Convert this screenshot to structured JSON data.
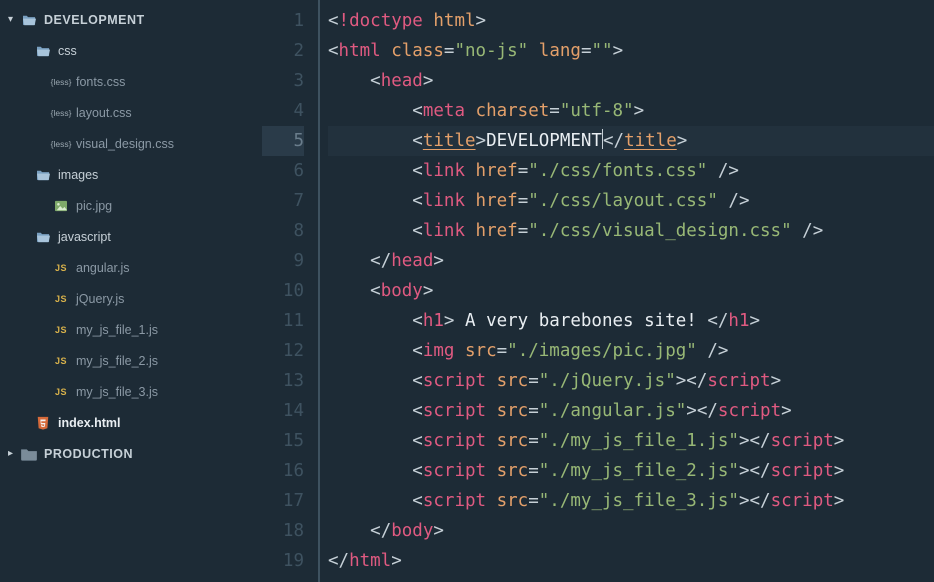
{
  "sidebar": {
    "items": [
      {
        "type": "root-open",
        "label": "DEVELOPMENT"
      },
      {
        "type": "folder-open",
        "indent": 1,
        "label": "css"
      },
      {
        "type": "less-file",
        "indent": 2,
        "label": "fonts.css"
      },
      {
        "type": "less-file",
        "indent": 2,
        "label": "layout.css"
      },
      {
        "type": "less-file",
        "indent": 2,
        "label": "visual_design.css"
      },
      {
        "type": "folder-open",
        "indent": 1,
        "label": "images"
      },
      {
        "type": "image-file",
        "indent": 2,
        "label": "pic.jpg"
      },
      {
        "type": "folder-open",
        "indent": 1,
        "label": "javascript"
      },
      {
        "type": "js-file",
        "indent": 2,
        "label": "angular.js"
      },
      {
        "type": "js-file",
        "indent": 2,
        "label": "jQuery.js"
      },
      {
        "type": "js-file",
        "indent": 2,
        "label": "my_js_file_1.js"
      },
      {
        "type": "js-file",
        "indent": 2,
        "label": "my_js_file_2.js"
      },
      {
        "type": "js-file",
        "indent": 2,
        "label": "my_js_file_3.js"
      },
      {
        "type": "html-file",
        "indent": 1,
        "label": "index.html",
        "bold": true
      },
      {
        "type": "root-closed",
        "label": "PRODUCTION"
      }
    ]
  },
  "editor": {
    "active_line": 5,
    "lines": [
      {
        "n": 1,
        "tokens": [
          [
            "<",
            "punct"
          ],
          [
            "!doctype ",
            "bang"
          ],
          [
            "html",
            "attr"
          ],
          [
            ">",
            "punct"
          ]
        ]
      },
      {
        "n": 2,
        "tokens": [
          [
            "<",
            "punct"
          ],
          [
            "html ",
            "tag"
          ],
          [
            "class",
            "attr"
          ],
          [
            "=",
            "punct"
          ],
          [
            "\"no-js\"",
            "str"
          ],
          [
            " ",
            "punct"
          ],
          [
            "lang",
            "attr"
          ],
          [
            "=",
            "punct"
          ],
          [
            "\"\"",
            "str"
          ],
          [
            ">",
            "punct"
          ]
        ]
      },
      {
        "n": 3,
        "indent": 1,
        "tokens": [
          [
            "<",
            "punct"
          ],
          [
            "head",
            "tag"
          ],
          [
            ">",
            "punct"
          ]
        ]
      },
      {
        "n": 4,
        "indent": 2,
        "tokens": [
          [
            "<",
            "punct"
          ],
          [
            "meta ",
            "tag"
          ],
          [
            "charset",
            "attr"
          ],
          [
            "=",
            "punct"
          ],
          [
            "\"utf-8\"",
            "str"
          ],
          [
            ">",
            "punct"
          ]
        ]
      },
      {
        "n": 5,
        "indent": 2,
        "active": true,
        "tokens": [
          [
            "<",
            "punct"
          ],
          [
            "title",
            "tag-title"
          ],
          [
            ">",
            "punct"
          ],
          [
            "DEVELOPMENT",
            "text"
          ],
          [
            "|",
            "cursor"
          ],
          [
            "</",
            "punct"
          ],
          [
            "title",
            "tag-title"
          ],
          [
            ">",
            "punct"
          ]
        ]
      },
      {
        "n": 6,
        "indent": 2,
        "tokens": [
          [
            "<",
            "punct"
          ],
          [
            "link ",
            "tag"
          ],
          [
            "href",
            "attr"
          ],
          [
            "=",
            "punct"
          ],
          [
            "\"./css/fonts.css\"",
            "str"
          ],
          [
            " />",
            "punct"
          ]
        ]
      },
      {
        "n": 7,
        "indent": 2,
        "tokens": [
          [
            "<",
            "punct"
          ],
          [
            "link ",
            "tag"
          ],
          [
            "href",
            "attr"
          ],
          [
            "=",
            "punct"
          ],
          [
            "\"./css/layout.css\"",
            "str"
          ],
          [
            " />",
            "punct"
          ]
        ]
      },
      {
        "n": 8,
        "indent": 2,
        "tokens": [
          [
            "<",
            "punct"
          ],
          [
            "link ",
            "tag"
          ],
          [
            "href",
            "attr"
          ],
          [
            "=",
            "punct"
          ],
          [
            "\"./css/visual_design.css\"",
            "str"
          ],
          [
            " />",
            "punct"
          ]
        ]
      },
      {
        "n": 9,
        "indent": 1,
        "tokens": [
          [
            "</",
            "punct"
          ],
          [
            "head",
            "tag"
          ],
          [
            ">",
            "punct"
          ]
        ]
      },
      {
        "n": 10,
        "indent": 1,
        "tokens": [
          [
            "<",
            "punct"
          ],
          [
            "body",
            "tag"
          ],
          [
            ">",
            "punct"
          ]
        ]
      },
      {
        "n": 11,
        "indent": 2,
        "tokens": [
          [
            "<",
            "punct"
          ],
          [
            "h1",
            "tag"
          ],
          [
            ">",
            "punct"
          ],
          [
            " A very barebones site! ",
            "text"
          ],
          [
            "</",
            "punct"
          ],
          [
            "h1",
            "tag"
          ],
          [
            ">",
            "punct"
          ]
        ]
      },
      {
        "n": 12,
        "indent": 2,
        "tokens": [
          [
            "<",
            "punct"
          ],
          [
            "img ",
            "tag"
          ],
          [
            "src",
            "attr"
          ],
          [
            "=",
            "punct"
          ],
          [
            "\"./images/pic.jpg\"",
            "str"
          ],
          [
            " />",
            "punct"
          ]
        ]
      },
      {
        "n": 13,
        "indent": 2,
        "tokens": [
          [
            "<",
            "punct"
          ],
          [
            "script ",
            "tag"
          ],
          [
            "src",
            "attr"
          ],
          [
            "=",
            "punct"
          ],
          [
            "\"./jQuery.js\"",
            "str"
          ],
          [
            ">",
            "punct"
          ],
          [
            "</",
            "punct"
          ],
          [
            "script",
            "tag"
          ],
          [
            ">",
            "punct"
          ]
        ]
      },
      {
        "n": 14,
        "indent": 2,
        "tokens": [
          [
            "<",
            "punct"
          ],
          [
            "script ",
            "tag"
          ],
          [
            "src",
            "attr"
          ],
          [
            "=",
            "punct"
          ],
          [
            "\"./angular.js\"",
            "str"
          ],
          [
            ">",
            "punct"
          ],
          [
            "</",
            "punct"
          ],
          [
            "script",
            "tag"
          ],
          [
            ">",
            "punct"
          ]
        ]
      },
      {
        "n": 15,
        "indent": 2,
        "tokens": [
          [
            "<",
            "punct"
          ],
          [
            "script ",
            "tag"
          ],
          [
            "src",
            "attr"
          ],
          [
            "=",
            "punct"
          ],
          [
            "\"./my_js_file_1.js\"",
            "str"
          ],
          [
            ">",
            "punct"
          ],
          [
            "</",
            "punct"
          ],
          [
            "script",
            "tag"
          ],
          [
            ">",
            "punct"
          ]
        ]
      },
      {
        "n": 16,
        "indent": 2,
        "tokens": [
          [
            "<",
            "punct"
          ],
          [
            "script ",
            "tag"
          ],
          [
            "src",
            "attr"
          ],
          [
            "=",
            "punct"
          ],
          [
            "\"./my_js_file_2.js\"",
            "str"
          ],
          [
            ">",
            "punct"
          ],
          [
            "</",
            "punct"
          ],
          [
            "script",
            "tag"
          ],
          [
            ">",
            "punct"
          ]
        ]
      },
      {
        "n": 17,
        "indent": 2,
        "tokens": [
          [
            "<",
            "punct"
          ],
          [
            "script ",
            "tag"
          ],
          [
            "src",
            "attr"
          ],
          [
            "=",
            "punct"
          ],
          [
            "\"./my_js_file_3.js\"",
            "str"
          ],
          [
            ">",
            "punct"
          ],
          [
            "</",
            "punct"
          ],
          [
            "script",
            "tag"
          ],
          [
            ">",
            "punct"
          ]
        ]
      },
      {
        "n": 18,
        "indent": 1,
        "tokens": [
          [
            "</",
            "punct"
          ],
          [
            "body",
            "tag"
          ],
          [
            ">",
            "punct"
          ]
        ]
      },
      {
        "n": 19,
        "tokens": [
          [
            "</",
            "punct"
          ],
          [
            "html",
            "tag"
          ],
          [
            ">",
            "punct"
          ]
        ]
      }
    ]
  },
  "badges": {
    "less": "{less}",
    "js": "JS"
  }
}
